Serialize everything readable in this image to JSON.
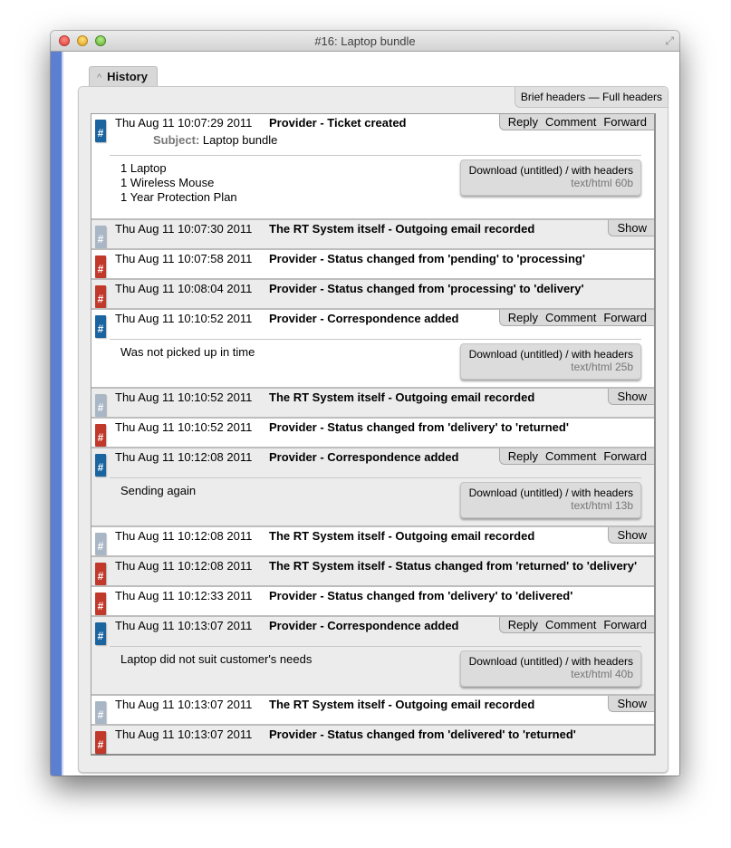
{
  "window": {
    "title": "#16: Laptop bundle"
  },
  "tab": {
    "label": "History"
  },
  "headers_toggle": {
    "brief": "Brief headers",
    "separator": " — ",
    "full": "Full headers"
  },
  "actions": {
    "reply": "Reply",
    "comment": "Comment",
    "forward": "Forward",
    "show": "Show"
  },
  "subject_label": "Subject:",
  "download_label": "Download (untitled) / with headers",
  "badge_glyph": "#",
  "colors": {
    "correspondence": "#1a64a0",
    "status": "#c0392b",
    "system": "#a8b6c6",
    "sidebar": "#5b7fd1"
  },
  "transactions": [
    {
      "date": "Thu Aug 11 10:07:29 2011",
      "desc": "Provider - Ticket created",
      "type": "correspondence",
      "subject": "Laptop bundle",
      "body": [
        "1 Laptop",
        "1 Wireless Mouse",
        "1 Year Protection Plan"
      ],
      "attachment": "text/html 60b"
    },
    {
      "date": "Thu Aug 11 10:07:30 2011",
      "desc": "The RT System itself - Outgoing email recorded",
      "type": "system"
    },
    {
      "date": "Thu Aug 11 10:07:58 2011",
      "desc": "Provider - Status changed from 'pending' to 'processing'",
      "type": "status"
    },
    {
      "date": "Thu Aug 11 10:08:04 2011",
      "desc": "Provider - Status changed from 'processing' to 'delivery'",
      "type": "status"
    },
    {
      "date": "Thu Aug 11 10:10:52 2011",
      "desc": "Provider - Correspondence added",
      "type": "correspondence",
      "body": [
        "Was not picked up in time"
      ],
      "attachment": "text/html 25b"
    },
    {
      "date": "Thu Aug 11 10:10:52 2011",
      "desc": "The RT System itself - Outgoing email recorded",
      "type": "system"
    },
    {
      "date": "Thu Aug 11 10:10:52 2011",
      "desc": "Provider - Status changed from 'delivery' to 'returned'",
      "type": "status"
    },
    {
      "date": "Thu Aug 11 10:12:08 2011",
      "desc": "Provider - Correspondence added",
      "type": "correspondence",
      "body": [
        "Sending again"
      ],
      "attachment": "text/html 13b"
    },
    {
      "date": "Thu Aug 11 10:12:08 2011",
      "desc": "The RT System itself - Outgoing email recorded",
      "type": "system"
    },
    {
      "date": "Thu Aug 11 10:12:08 2011",
      "desc": "The RT System itself - Status changed from 'returned' to 'delivery'",
      "type": "status"
    },
    {
      "date": "Thu Aug 11 10:12:33 2011",
      "desc": "Provider - Status changed from 'delivery' to 'delivered'",
      "type": "status"
    },
    {
      "date": "Thu Aug 11 10:13:07 2011",
      "desc": "Provider - Correspondence added",
      "type": "correspondence",
      "body": [
        "Laptop did not suit customer's needs"
      ],
      "attachment": "text/html 40b"
    },
    {
      "date": "Thu Aug 11 10:13:07 2011",
      "desc": "The RT System itself - Outgoing email recorded",
      "type": "system"
    },
    {
      "date": "Thu Aug 11 10:13:07 2011",
      "desc": "Provider - Status changed from 'delivered' to 'returned'",
      "type": "status"
    }
  ]
}
